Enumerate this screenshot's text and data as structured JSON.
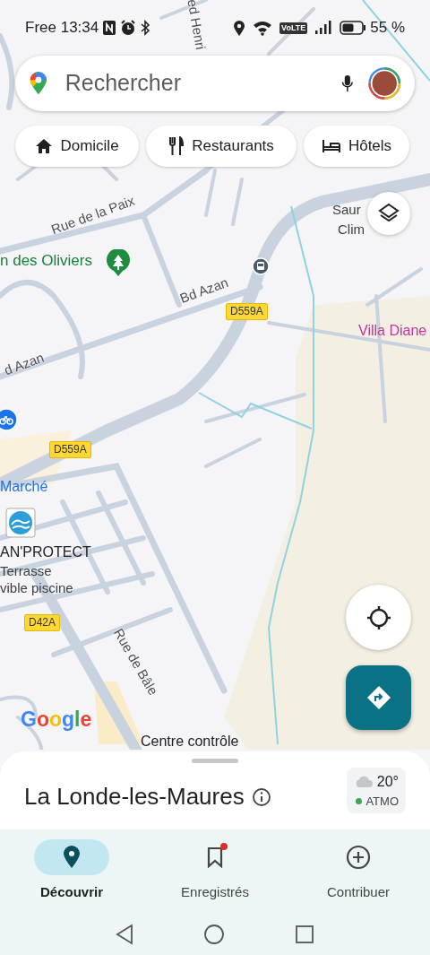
{
  "status_bar": {
    "carrier_time": "Free 13:34",
    "network": "VoLTE",
    "battery_text": "55 %"
  },
  "search": {
    "placeholder": "Rechercher"
  },
  "chips": [
    {
      "label": "Domicile"
    },
    {
      "label": "Restaurants"
    },
    {
      "label": "Hôtels"
    }
  ],
  "map": {
    "labels": [
      {
        "kind": "street",
        "text": "ed Henri"
      },
      {
        "kind": "street",
        "text": "Rue de la Paix"
      },
      {
        "kind": "park",
        "text": "n des Oliviers"
      },
      {
        "kind": "street",
        "text": "Bd Azan"
      },
      {
        "kind": "shield",
        "text": "D559A"
      },
      {
        "kind": "place",
        "text": "Saur"
      },
      {
        "kind": "place",
        "text": "Clim"
      },
      {
        "kind": "lodging",
        "text": "Villa Diane"
      },
      {
        "kind": "street",
        "text": "d Azan"
      },
      {
        "kind": "shield",
        "text": "D559A"
      },
      {
        "kind": "transit",
        "text": "Marché"
      },
      {
        "kind": "business",
        "text": "AN'PROTECT"
      },
      {
        "kind": "place",
        "text": "Terrasse"
      },
      {
        "kind": "place",
        "text": "vible piscine"
      },
      {
        "kind": "shield",
        "text": "D42A"
      },
      {
        "kind": "street",
        "text": "Rue de Bâle"
      },
      {
        "kind": "business",
        "text": "Centre contrôle"
      }
    ],
    "attribution": "Google"
  },
  "sheet": {
    "title": "La Londe-les-Maures",
    "weather": {
      "temperature": "20°",
      "air_quality": "ATMO"
    }
  },
  "bottom_nav": [
    {
      "label": "Découvrir",
      "selected": true,
      "badge": false
    },
    {
      "label": "Enregistrés",
      "selected": false,
      "badge": true
    },
    {
      "label": "Contribuer",
      "selected": false,
      "badge": false
    }
  ]
}
